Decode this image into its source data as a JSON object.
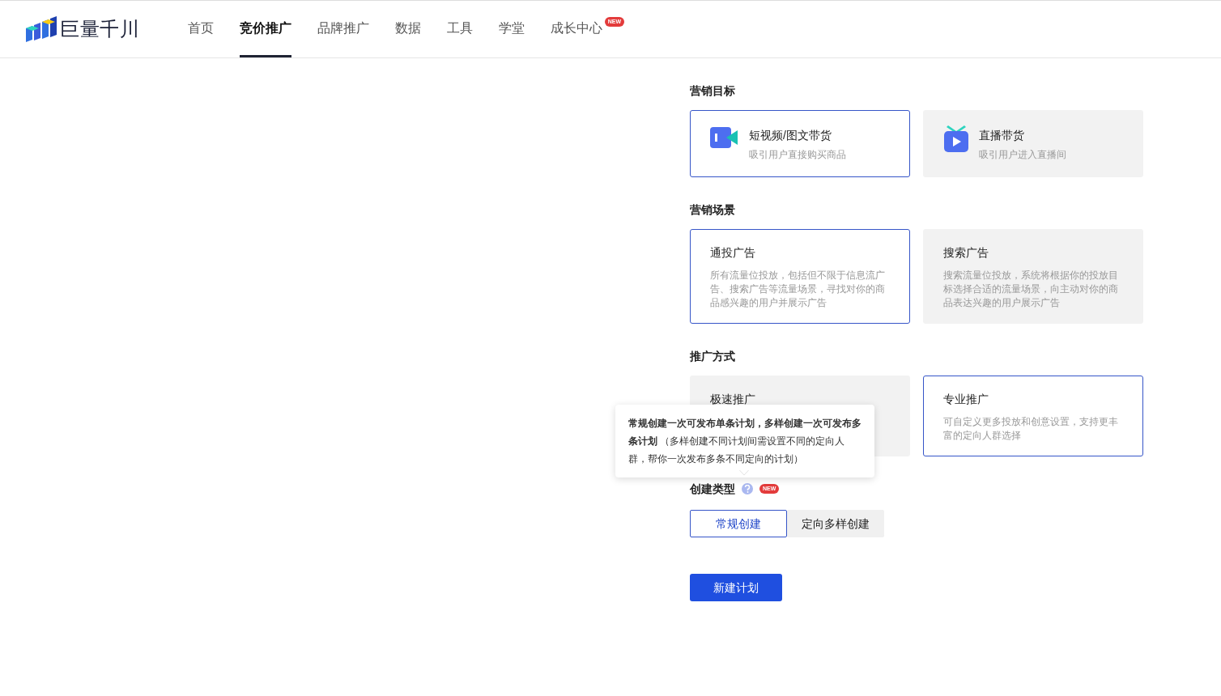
{
  "header": {
    "logo": "巨量千川",
    "nav": [
      {
        "label": "首页",
        "selected": false
      },
      {
        "label": "竞价推广",
        "selected": true
      },
      {
        "label": "品牌推广",
        "selected": false
      },
      {
        "label": "数据",
        "selected": false
      },
      {
        "label": "工具",
        "selected": false
      },
      {
        "label": "学堂",
        "selected": false
      },
      {
        "label": "成长中心",
        "selected": false,
        "badge": "NEW"
      }
    ]
  },
  "sections": [
    {
      "title": "营销目标",
      "options": [
        {
          "kind": "video",
          "title": "短视频/图文带货",
          "desc": "吸引用户直接购买商品",
          "selected": true
        },
        {
          "kind": "live",
          "title": "直播带货",
          "desc": "吸引用户进入直播间",
          "selected": false
        }
      ]
    },
    {
      "title": "营销场景",
      "options": [
        {
          "kind": "text",
          "title": "通投广告",
          "desc": "所有流量位投放，包括但不限于信息流广告、搜索广告等流量场景，寻找对你的商品感兴趣的用户并展示广告",
          "selected": true
        },
        {
          "kind": "text",
          "title": "搜索广告",
          "desc": "搜索流量位投放，系统将根据你的投放目标选择合适的流量场景，向主动对你的商品表达兴趣的用户展示广告",
          "selected": false
        }
      ]
    },
    {
      "title": "推广方式",
      "options": [
        {
          "kind": "text",
          "title": "极速推广",
          "selected": false
        },
        {
          "kind": "text",
          "title": "专业推广",
          "desc": "可自定义更多投放和创意设置，支持更丰富的定向人群选择",
          "selected": true
        }
      ]
    }
  ],
  "create_type": {
    "label": "创建类型",
    "badge": "NEW",
    "tooltip": "**常规创建一次可发布单条计划，多样创建一次可发布多条计划** （多样创建不同计划间需设置不同的定向人群，帮你一次发布多条不同定向的计划）",
    "options": [
      {
        "label": "常规创建",
        "selected": true
      },
      {
        "label": "定向多样创建",
        "selected": false
      }
    ]
  },
  "submit": "新建计划"
}
